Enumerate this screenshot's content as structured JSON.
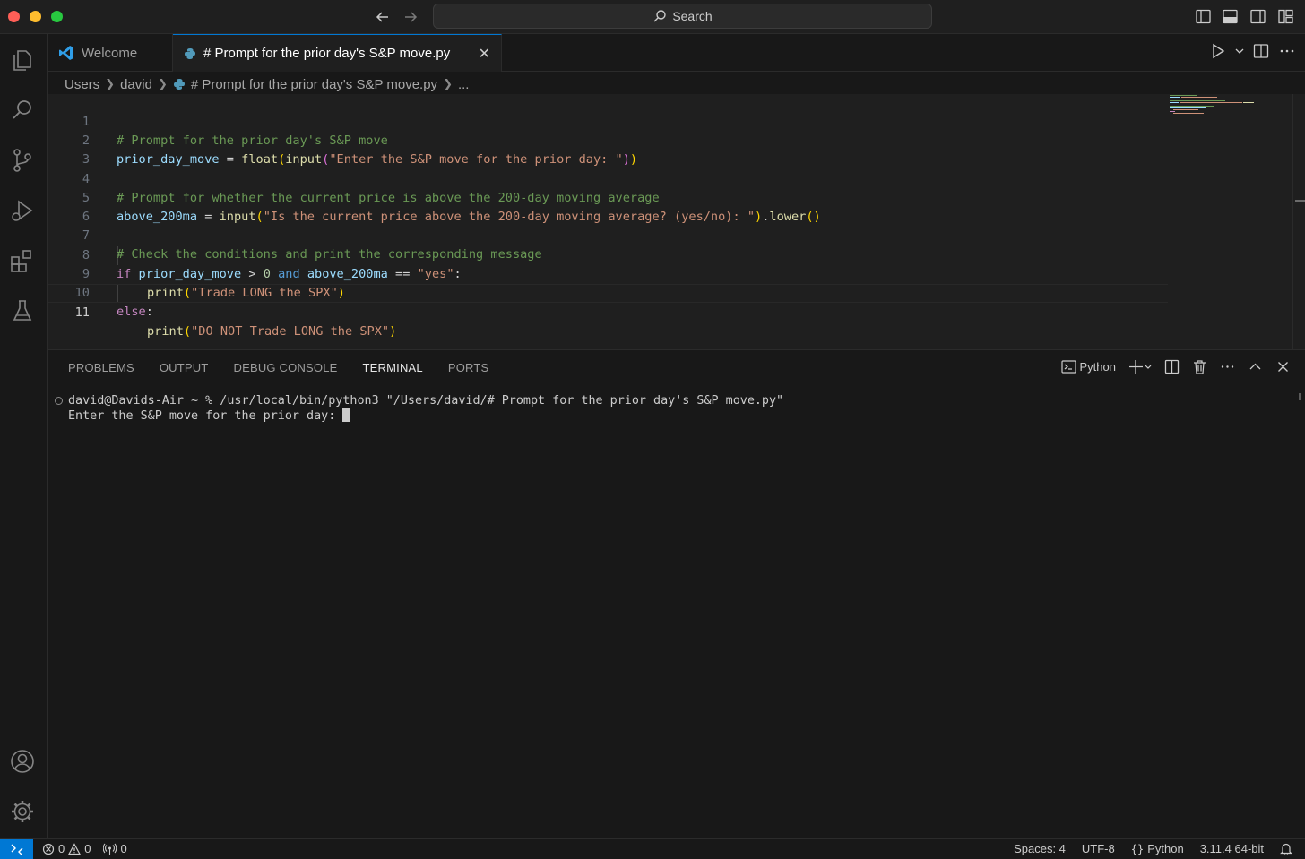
{
  "titlebar": {
    "search_label": "Search"
  },
  "tabs": [
    {
      "label": "Welcome"
    },
    {
      "label": "# Prompt for the prior day's S&P move.py"
    }
  ],
  "breadcrumb": {
    "items": [
      "Users",
      "david",
      "# Prompt for the prior day's S&P move.py",
      "..."
    ]
  },
  "editor": {
    "lines": [
      {
        "num": "1"
      },
      {
        "num": "2"
      },
      {
        "num": "3"
      },
      {
        "num": "4"
      },
      {
        "num": "5"
      },
      {
        "num": "6"
      },
      {
        "num": "7"
      },
      {
        "num": "8"
      },
      {
        "num": "9"
      },
      {
        "num": "10"
      },
      {
        "num": "11"
      }
    ],
    "tokens": {
      "l1_comment": "# Prompt for the prior day's S&P move",
      "l2_var": "prior_day_move",
      "l2_eq": " = ",
      "l2_fn1": "float",
      "l2_p1": "(",
      "l2_fn2": "input",
      "l2_p2": "(",
      "l2_str": "\"Enter the S&P move for the prior day: \"",
      "l2_p3": ")",
      "l2_p4": ")",
      "l4_comment": "# Prompt for whether the current price is above the 200-day moving average",
      "l5_var": "above_200ma",
      "l5_eq": " = ",
      "l5_fn": "input",
      "l5_p1": "(",
      "l5_str": "\"Is the current price above the 200-day moving average? (yes/no): \"",
      "l5_p2": ")",
      "l5_dot": ".",
      "l5_fn2": "lower",
      "l5_p3": "()",
      "l7_comment": "# Check the conditions and print the corresponding message",
      "l8_if": "if",
      "l8_var1": " prior_day_move",
      "l8_gt": " > ",
      "l8_num": "0",
      "l8_and": " and",
      "l8_var2": " above_200ma",
      "l8_eqeq": " == ",
      "l8_str": "\"yes\"",
      "l8_colon": ":",
      "l9_fn": "print",
      "l9_p1": "(",
      "l9_str": "\"Trade LONG the SPX\"",
      "l9_p2": ")",
      "l10_else": "else",
      "l10_colon": ":",
      "l11_fn": "print",
      "l11_p1": "(",
      "l11_str": "\"DO NOT Trade LONG the SPX\"",
      "l11_p2": ")"
    }
  },
  "panel": {
    "tabs": [
      "PROBLEMS",
      "OUTPUT",
      "DEBUG CONSOLE",
      "TERMINAL",
      "PORTS"
    ],
    "active_tab": "TERMINAL",
    "terminal_profile": "Python",
    "terminal_lines": [
      "david@Davids-Air ~ % /usr/local/bin/python3 \"/Users/david/# Prompt for the prior day's S&P move.py\"",
      "Enter the S&P move for the prior day: "
    ]
  },
  "statusbar": {
    "errors": "0",
    "warnings": "0",
    "ports": "0",
    "spaces": "Spaces: 4",
    "encoding": "UTF-8",
    "language": "Python",
    "interpreter": "3.11.4 64-bit"
  },
  "colors": {
    "accent": "#0078d4",
    "editor_bg": "#1f1f1f",
    "chrome_bg": "#181818"
  }
}
